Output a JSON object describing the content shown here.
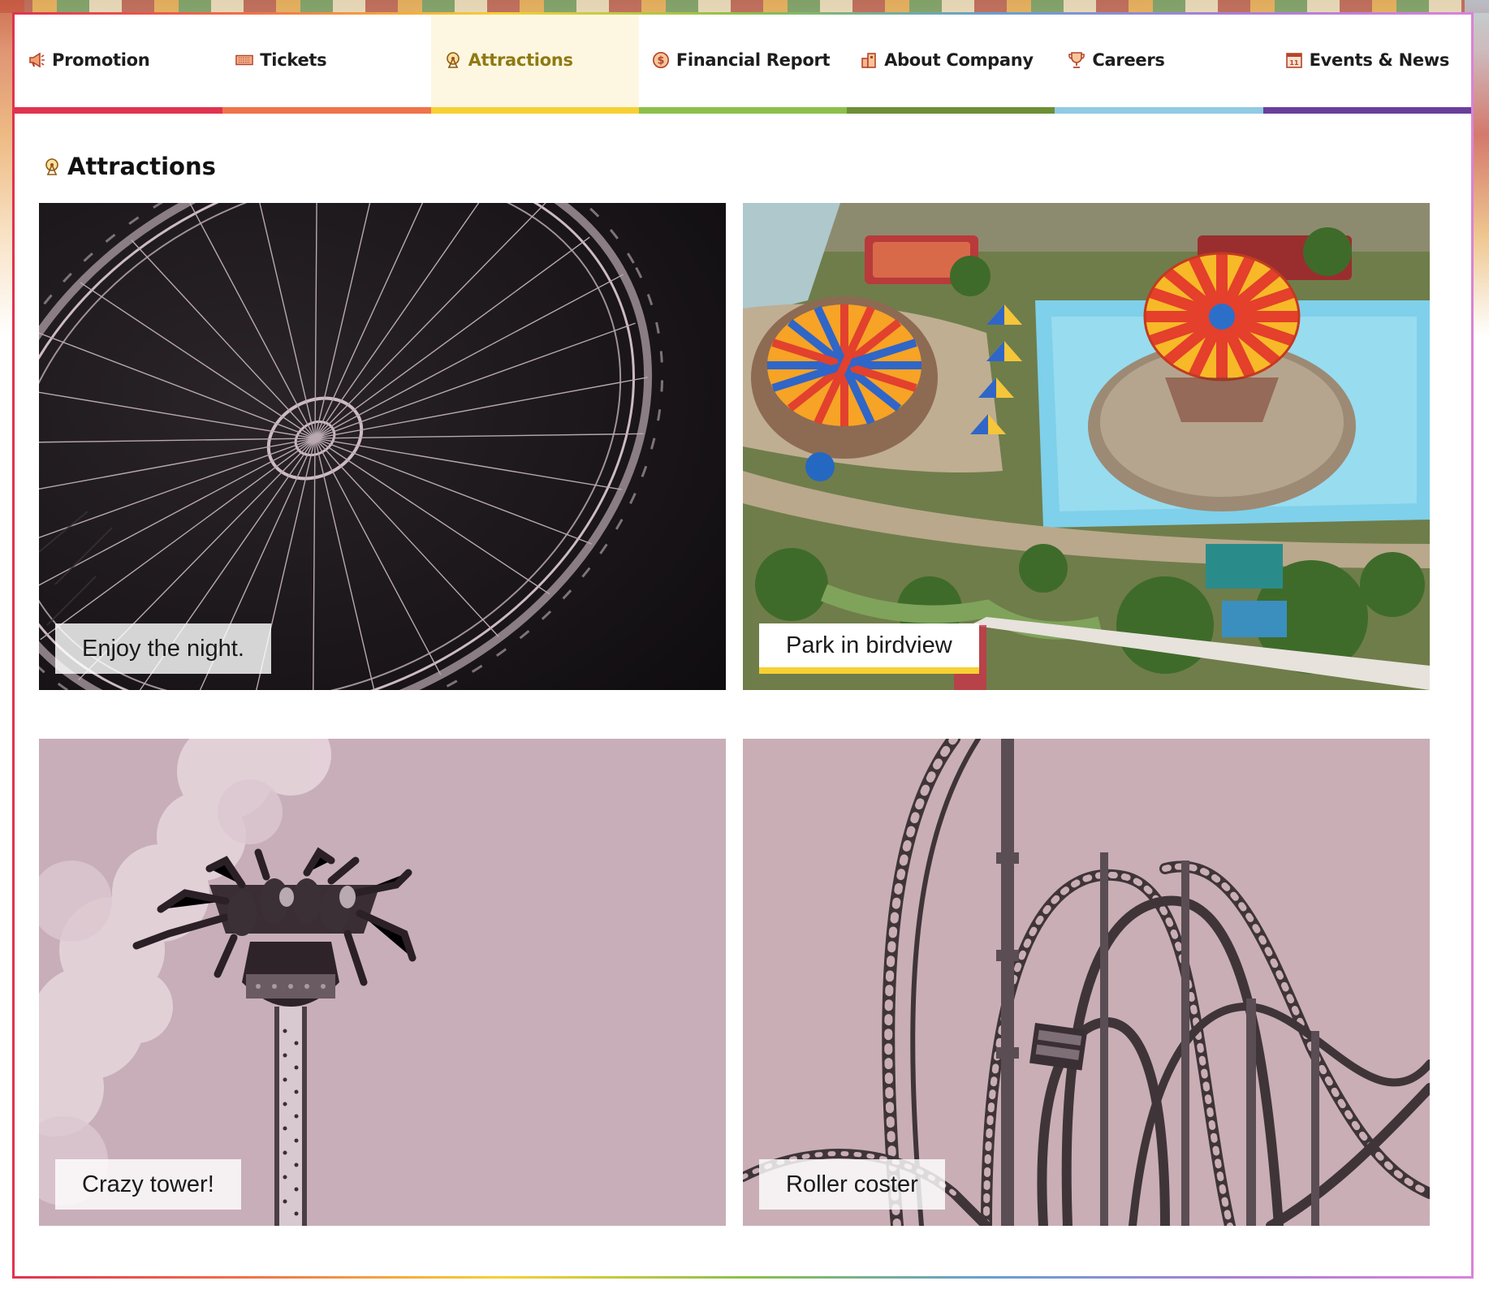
{
  "nav": {
    "items": [
      {
        "label": "Promotion",
        "icon": "megaphone-icon",
        "color": "#e0334f",
        "active": false
      },
      {
        "label": "Tickets",
        "icon": "ticket-icon",
        "color": "#f0734a",
        "active": false
      },
      {
        "label": "Attractions",
        "icon": "ferris-wheel-icon",
        "color": "#f7d034",
        "active": true
      },
      {
        "label": "Financial Report",
        "icon": "dollar-coin-icon",
        "color": "#8cc04a",
        "active": false
      },
      {
        "label": "About Company",
        "icon": "building-icon",
        "color": "#6e8f35",
        "active": false
      },
      {
        "label": "Careers",
        "icon": "trophy-icon",
        "color": "#8fcbe3",
        "active": false
      },
      {
        "label": "Events & News",
        "icon": "calendar-icon",
        "color": "#6a3f9a",
        "active": false
      }
    ]
  },
  "section": {
    "title": "Attractions",
    "icon": "ferris-wheel-icon"
  },
  "cards": [
    {
      "caption": "Enjoy the night.",
      "image": "ferris-wheel-night-photo"
    },
    {
      "caption": "Park in birdview",
      "image": "amusement-park-aerial-photo",
      "highlighted": true
    },
    {
      "caption": "Crazy tower!",
      "image": "drop-tower-photo"
    },
    {
      "caption": "Roller coster",
      "image": "roller-coaster-photo"
    }
  ],
  "colors": {
    "accent": "#f7d034",
    "active_text": "#8f7a12",
    "active_bg": "#fdf7e1"
  }
}
